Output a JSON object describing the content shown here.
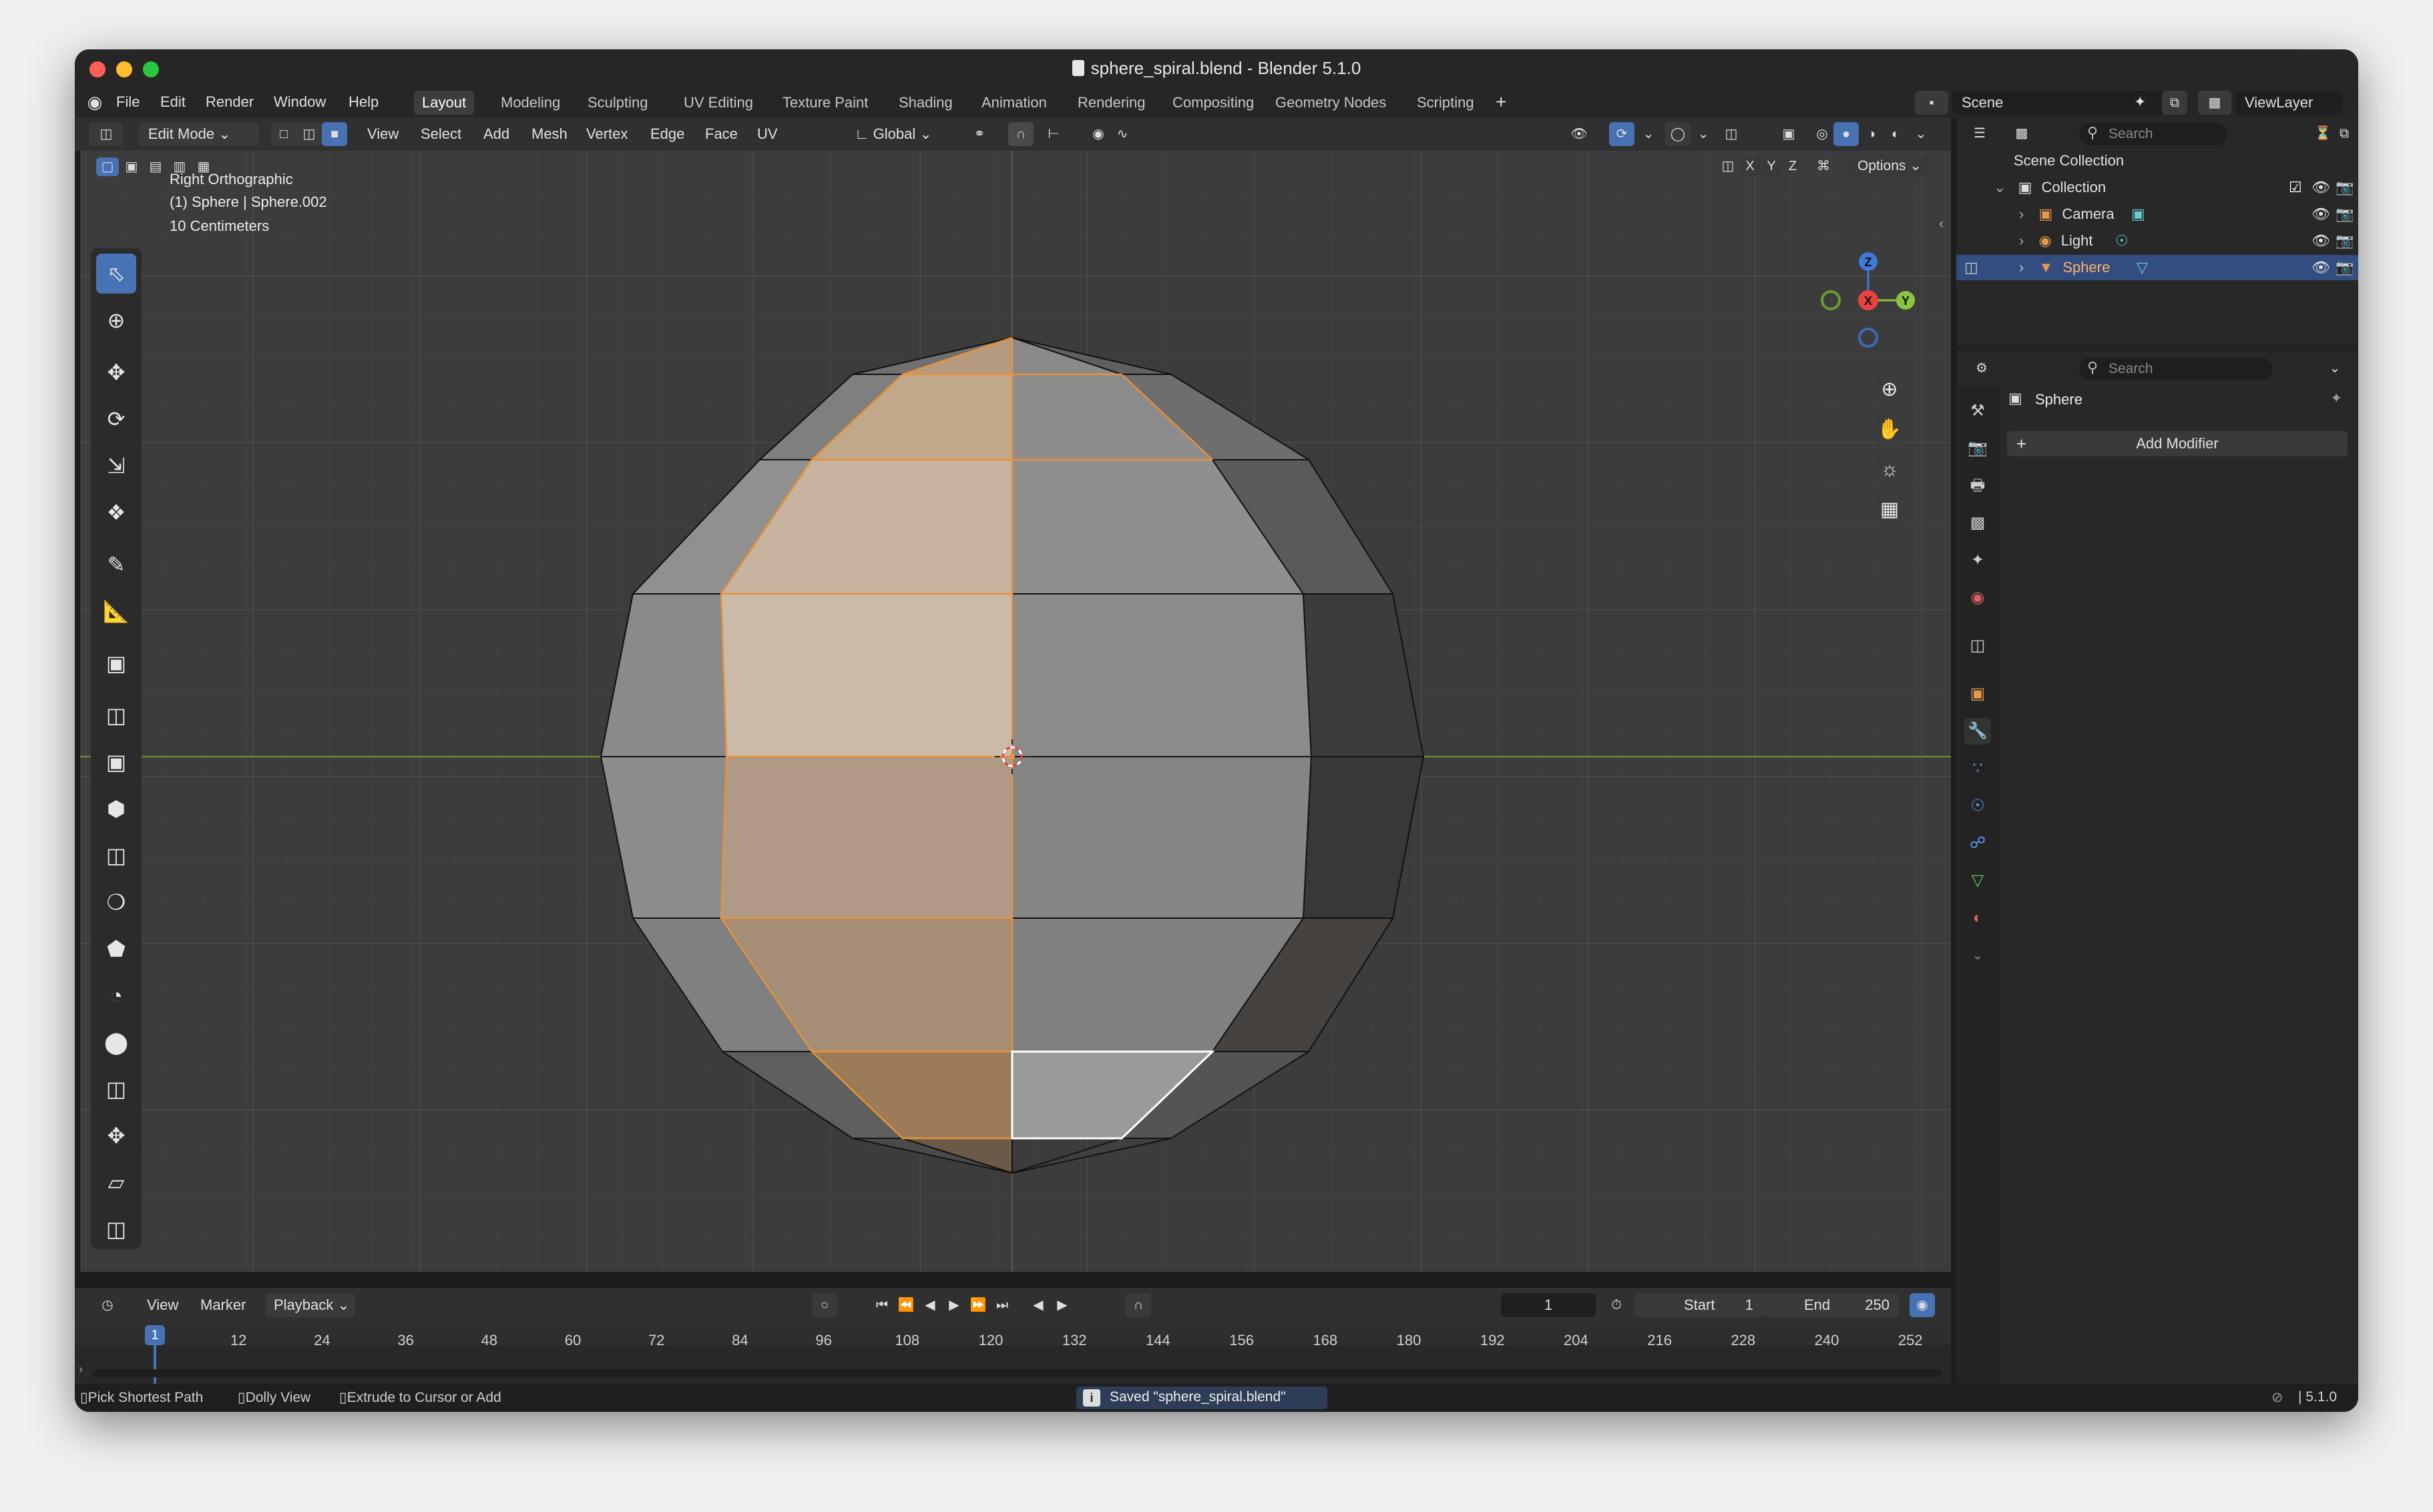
{
  "window": {
    "title": "sphere_spiral.blend - Blender 5.1.0"
  },
  "menu": {
    "items": [
      "File",
      "Edit",
      "Render",
      "Window",
      "Help"
    ]
  },
  "workspaces": [
    "Layout",
    "Modeling",
    "Sculpting",
    "UV Editing",
    "Texture Paint",
    "Shading",
    "Animation",
    "Rendering",
    "Compositing",
    "Geometry Nodes",
    "Scripting"
  ],
  "active_workspace": "Layout",
  "scene": {
    "name": "Scene",
    "view_layer": "ViewLayer"
  },
  "viewport_header": {
    "mode": "Edit Mode",
    "menus": [
      "View",
      "Select",
      "Add",
      "Mesh",
      "Vertex",
      "Edge",
      "Face",
      "UV"
    ],
    "orientation": "Global",
    "options_label": "Options",
    "axes": [
      "X",
      "Y",
      "Z"
    ]
  },
  "viewport": {
    "view_name": "Right Orthographic",
    "object_info": "(1) Sphere | Sphere.002",
    "scale": "10 Centimeters"
  },
  "gizmo": {
    "z": "Z",
    "x": "X",
    "y": "Y"
  },
  "outliner": {
    "search_placeholder": "Search",
    "scene_collection": "Scene Collection",
    "collection": "Collection",
    "objects": [
      "Camera",
      "Light",
      "Sphere"
    ],
    "selected": "Sphere"
  },
  "properties": {
    "search_placeholder": "Search",
    "object_name": "Sphere",
    "add_modifier": "Add Modifier"
  },
  "timeline": {
    "menus": [
      "View",
      "Marker",
      "Playback"
    ],
    "current_frame": "1",
    "start_label": "Start",
    "start_value": "1",
    "end_label": "End",
    "end_value": "250",
    "frame_ticks": [
      "12",
      "24",
      "36",
      "48",
      "60",
      "72",
      "84",
      "96",
      "108",
      "120",
      "132",
      "144",
      "156",
      "168",
      "180",
      "192",
      "204",
      "216",
      "228",
      "240",
      "252"
    ],
    "playhead": "1"
  },
  "status": {
    "hints": [
      "Pick Shortest Path",
      "Dolly View",
      "Extrude to Cursor or Add"
    ],
    "message": "Saved \"sphere_spiral.blend\"",
    "version": "5.1.0"
  },
  "colors": {
    "accent": "#4772b3",
    "selection": "#e8923a",
    "x_axis": "#e8433f",
    "y_axis": "#8bc53f",
    "z_axis": "#3f7ad8"
  }
}
